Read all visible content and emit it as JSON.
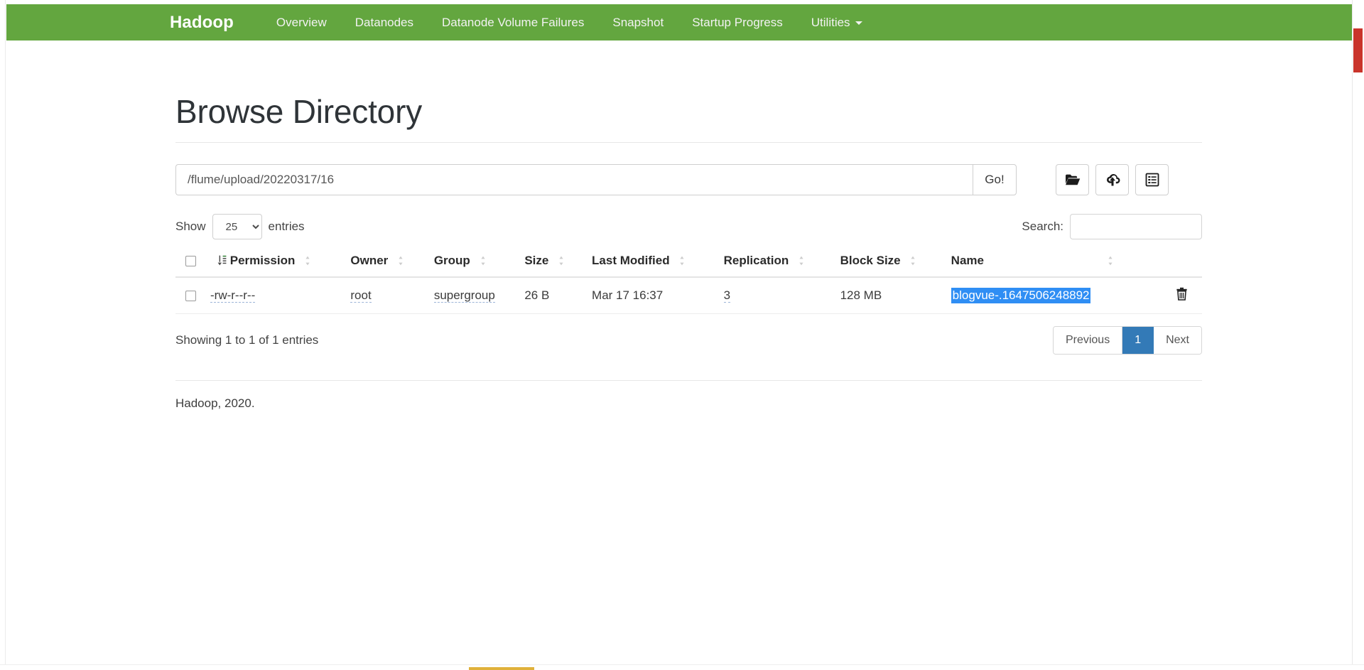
{
  "navbar": {
    "brand": "Hadoop",
    "items": [
      {
        "label": "Overview",
        "has_caret": false
      },
      {
        "label": "Datanodes",
        "has_caret": false
      },
      {
        "label": "Datanode Volume Failures",
        "has_caret": false
      },
      {
        "label": "Snapshot",
        "has_caret": false
      },
      {
        "label": "Startup Progress",
        "has_caret": false
      },
      {
        "label": "Utilities",
        "has_caret": true
      }
    ],
    "background_color": "#63a63f"
  },
  "page": {
    "title": "Browse Directory"
  },
  "path_bar": {
    "value": "/flume/upload/20220317/16",
    "placeholder": "Enter path",
    "go_label": "Go!",
    "tools": [
      {
        "name": "create-directory",
        "icon": "folder-icon"
      },
      {
        "name": "upload-files",
        "icon": "cloud-upload-icon"
      },
      {
        "name": "cut-paste",
        "icon": "clipboard-list-icon"
      }
    ]
  },
  "table_controls": {
    "show_label": "Show",
    "entries_label": "entries",
    "page_length": "25",
    "page_length_options": [
      "25",
      "50",
      "100"
    ],
    "search_label": "Search:",
    "search_value": "",
    "search_placeholder": ""
  },
  "table": {
    "columns": [
      {
        "label": "",
        "sortable": true,
        "icon": "sort-amount-icon"
      },
      {
        "label": "Permission",
        "sortable": true
      },
      {
        "label": "Owner",
        "sortable": true
      },
      {
        "label": "Group",
        "sortable": true
      },
      {
        "label": "Size",
        "sortable": true
      },
      {
        "label": "Last Modified",
        "sortable": true
      },
      {
        "label": "Replication",
        "sortable": true
      },
      {
        "label": "Block Size",
        "sortable": true
      },
      {
        "label": "Name",
        "sortable": true
      },
      {
        "label": "",
        "sortable": false
      }
    ],
    "rows": [
      {
        "permission": "-rw-r--r--",
        "owner": "root",
        "group": "supergroup",
        "size": "26 B",
        "last_modified": "Mar 17 16:37",
        "replication": "3",
        "block_size": "128 MB",
        "name": "blogvue-.1647506248892",
        "name_selected": true,
        "delete_icon": "trash-icon"
      }
    ]
  },
  "table_footer": {
    "info": "Showing 1 to 1 of 1 entries",
    "previous_label": "Previous",
    "pages": [
      "1"
    ],
    "active_page": "1",
    "next_label": "Next",
    "active_page_color": "#337ab7"
  },
  "footer": {
    "copyright": "Hadoop, 2020."
  },
  "selection_color": "#2f8ef4"
}
